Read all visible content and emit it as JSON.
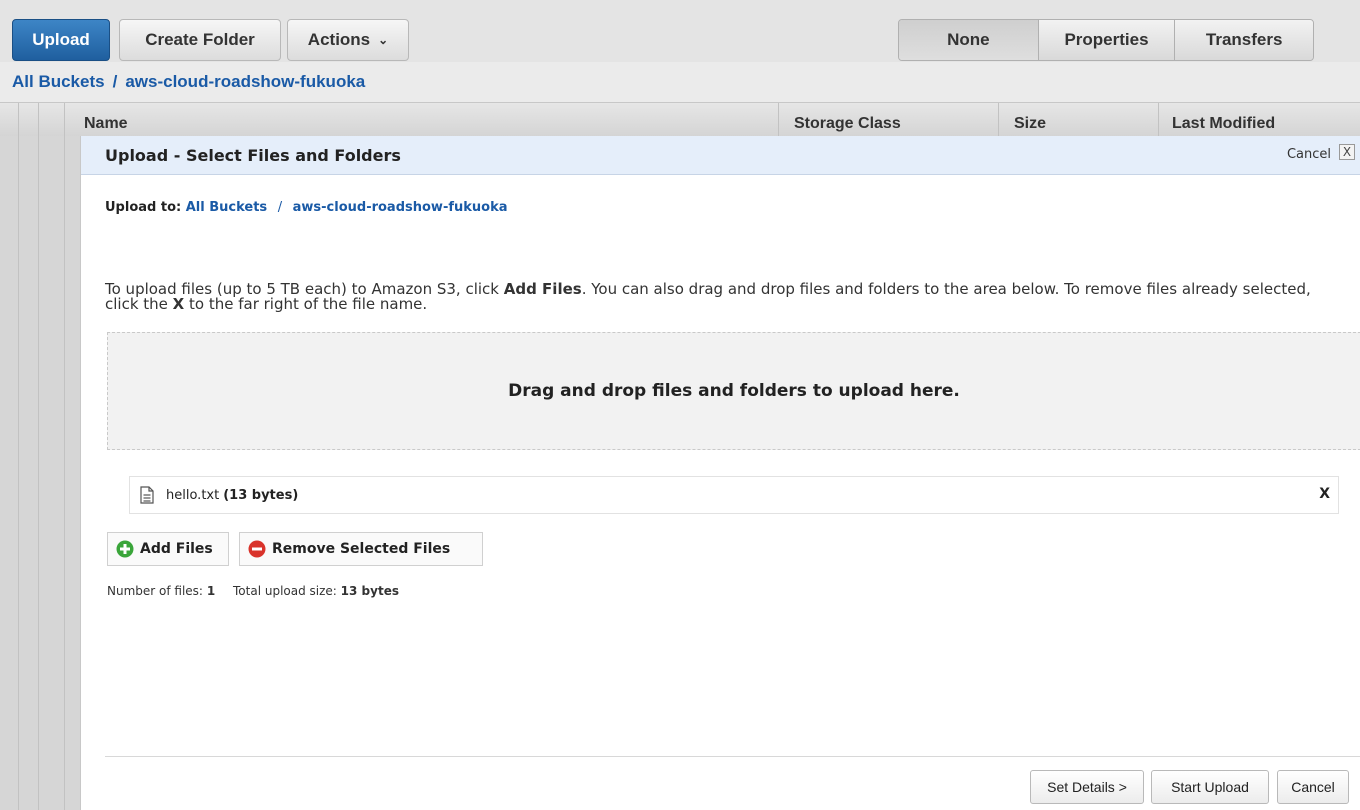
{
  "toolbar": {
    "upload_label": "Upload",
    "create_folder_label": "Create Folder",
    "actions_label": "Actions",
    "view_tabs": [
      "None",
      "Properties",
      "Transfers"
    ],
    "selected_view": "None"
  },
  "breadcrumb": {
    "root": "All Buckets",
    "separator": "/",
    "bucket": "aws-cloud-roadshow-fukuoka"
  },
  "table": {
    "columns": [
      "Name",
      "Storage Class",
      "Size",
      "Last Modified"
    ]
  },
  "dialog": {
    "title": "Upload - Select Files and Folders",
    "cancel_label": "Cancel",
    "close_label": "X",
    "upload_to_label": "Upload to:",
    "upload_to_root": "All Buckets",
    "upload_to_separator": "/",
    "upload_to_bucket": "aws-cloud-roadshow-fukuoka",
    "instructions": {
      "part1": "To upload files (up to 5 TB each) to Amazon S3, click ",
      "bold1": "Add Files",
      "part2": ". You can also drag and drop files and folders to the area below. To remove files already selected, click the ",
      "bold2": "X",
      "part3": " to the far right of the file name."
    },
    "dropzone_text": "Drag and drop files and folders to upload here.",
    "files": [
      {
        "name": "hello.txt",
        "size": "(13 bytes)",
        "remove": "X"
      }
    ],
    "add_files_label": "Add Files",
    "remove_selected_label": "Remove Selected Files",
    "summary": {
      "count_label": "Number of files:",
      "count_value": "1",
      "size_label": "Total upload size:",
      "size_value": "13 bytes"
    },
    "footer": {
      "set_details_label": "Set Details >",
      "start_upload_label": "Start Upload",
      "cancel_label": "Cancel"
    }
  },
  "colors": {
    "accent": "#1a5aa6",
    "upload_button": "#2e6fb3",
    "dialog_header": "#e5eefa",
    "add_icon": "#3aa53a",
    "remove_icon": "#d9332b"
  }
}
